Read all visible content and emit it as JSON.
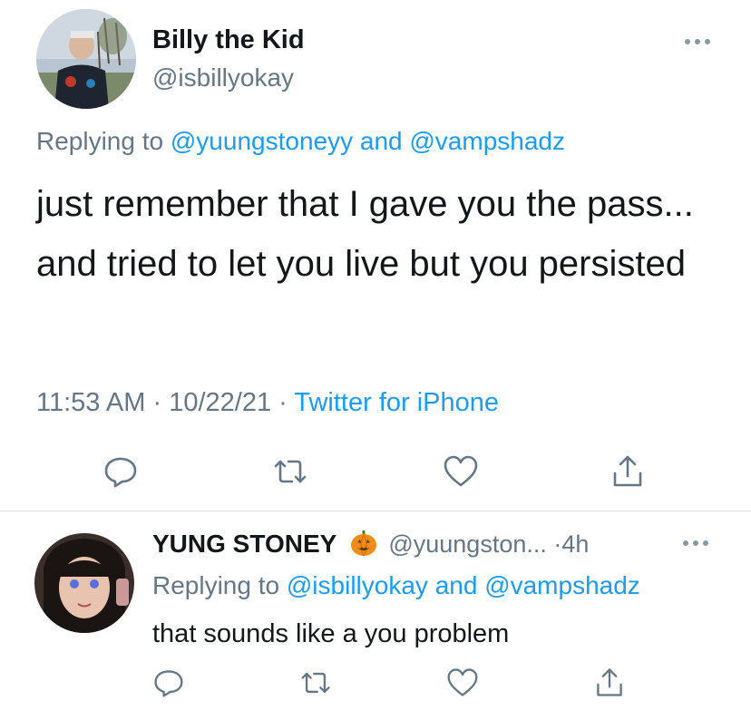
{
  "main_tweet": {
    "author_name": "Billy the Kid",
    "author_handle": "@isbillyokay",
    "replying_prefix": "Replying to",
    "replying_user1": "@yuungstoneyy",
    "replying_and": "and",
    "replying_user2": "@vampshadz",
    "text": "just remember that I gave you the pass... and tried to let you live but you persisted",
    "time": "11:53 AM",
    "sep1": "·",
    "date": "10/22/21",
    "sep2": "·",
    "source": "Twitter for iPhone",
    "actions": [
      "reply-icon",
      "retweet-icon",
      "like-icon",
      "share-icon"
    ]
  },
  "reply_tweet": {
    "author_name": "YUNG STONEY",
    "emoji": "pumpkin-icon",
    "author_handle": "@yuungston...",
    "sep": "·",
    "age": "4h",
    "replying_prefix": "Replying to",
    "replying_user1": "@isbillyokay",
    "replying_and": "and",
    "replying_user2": "@vampshadz",
    "text": "that sounds like a you problem",
    "actions": [
      "reply-icon",
      "retweet-icon",
      "like-icon",
      "share-icon"
    ]
  },
  "colors": {
    "link": "#1d9bf0",
    "muted": "#657786",
    "text": "#14171a",
    "divider": "#dfe3e7"
  }
}
